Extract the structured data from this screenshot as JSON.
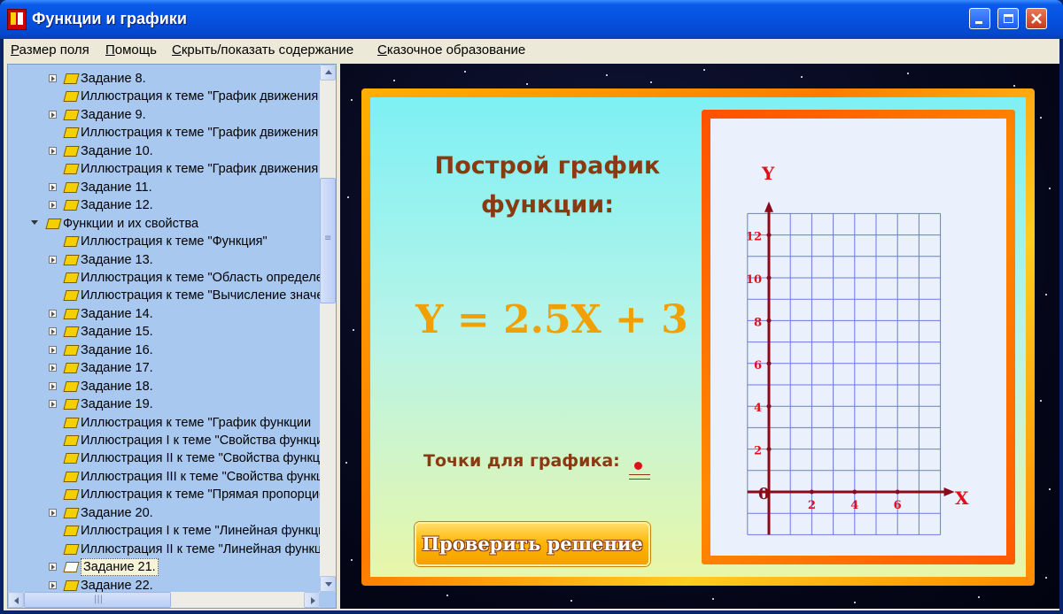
{
  "window": {
    "title": "Функции и графики"
  },
  "menu": [
    {
      "label": "Размер поля",
      "accel": "Р",
      "rest": "азмер поля"
    },
    {
      "label": "Помощь",
      "accel": "П",
      "rest": "омощь"
    },
    {
      "label": "Скрыть/показать содержание",
      "accel": "С",
      "rest": "крыть/показать содержание"
    },
    {
      "label": "Сказочное образование",
      "accel": "С",
      "rest": "казочное образование"
    }
  ],
  "tree": {
    "items": [
      {
        "label": "Задание 8.",
        "indent": 1,
        "expandable": true
      },
      {
        "label": "Иллюстрация к теме \"График движения",
        "indent": 2,
        "expandable": false
      },
      {
        "label": "Задание 9.",
        "indent": 1,
        "expandable": true
      },
      {
        "label": "Иллюстрация к теме \"График движения",
        "indent": 2,
        "expandable": false
      },
      {
        "label": "Задание 10.",
        "indent": 1,
        "expandable": true
      },
      {
        "label": "Иллюстрация к теме \"График движения",
        "indent": 2,
        "expandable": false
      },
      {
        "label": "Задание 11.",
        "indent": 1,
        "expandable": true
      },
      {
        "label": "Задание 12.",
        "indent": 1,
        "expandable": true
      },
      {
        "label": "Функции и их свойства",
        "indent": 0,
        "expandable": true,
        "open": true
      },
      {
        "label": "Иллюстрация к теме \"Функция\"",
        "indent": 2,
        "expandable": false
      },
      {
        "label": "Задание 13.",
        "indent": 1,
        "expandable": true
      },
      {
        "label": "Иллюстрация к теме \"Область определения",
        "indent": 2,
        "expandable": false
      },
      {
        "label": "Иллюстрация к теме \"Вычисление значений",
        "indent": 2,
        "expandable": false
      },
      {
        "label": "Задание 14.",
        "indent": 1,
        "expandable": true
      },
      {
        "label": "Задание 15.",
        "indent": 1,
        "expandable": true
      },
      {
        "label": "Задание 16.",
        "indent": 1,
        "expandable": true
      },
      {
        "label": "Задание 17.",
        "indent": 1,
        "expandable": true
      },
      {
        "label": "Задание 18.",
        "indent": 1,
        "expandable": true
      },
      {
        "label": "Задание 19.",
        "indent": 1,
        "expandable": true
      },
      {
        "label": "Иллюстрация к теме \"График функции",
        "indent": 2,
        "expandable": false
      },
      {
        "label": "Иллюстрация I к теме \"Свойства функции",
        "indent": 2,
        "expandable": false
      },
      {
        "label": "Иллюстрация II к теме \"Свойства функции",
        "indent": 2,
        "expandable": false
      },
      {
        "label": "Иллюстрация III к теме \"Свойства функции",
        "indent": 2,
        "expandable": false
      },
      {
        "label": "Иллюстрация к теме \"Прямая пропорциональность",
        "indent": 2,
        "expandable": false
      },
      {
        "label": "Задание 20.",
        "indent": 1,
        "expandable": true
      },
      {
        "label": "Иллюстрация I к теме \"Линейная функция",
        "indent": 2,
        "expandable": false
      },
      {
        "label": "Иллюстрация II к теме \"Линейная функция",
        "indent": 2,
        "expandable": false
      },
      {
        "label": "Задание 21.",
        "indent": 1,
        "expandable": true,
        "selected": true
      },
      {
        "label": "Задание 22.",
        "indent": 1,
        "expandable": true
      }
    ]
  },
  "task": {
    "heading_line1": "Построй график",
    "heading_line2": "функции:",
    "formula": "Y = 2.5X + 3",
    "points_label": "Точки для графика:",
    "check_button": "Проверить решение"
  },
  "graph": {
    "y_axis_label": "Y",
    "x_axis_label": "X",
    "origin_label": "0",
    "y_ticks": [
      "2",
      "4",
      "6",
      "8",
      "10",
      "12"
    ],
    "x_ticks": [
      "2",
      "4",
      "6"
    ]
  },
  "colors": {
    "tree_bg": "#a8c8f0",
    "heading": "#8a3a10",
    "formula": "#f0a000",
    "axis": "#8b0a1a",
    "grid": "#6a78e8",
    "tick_labels": "#e0101a"
  }
}
